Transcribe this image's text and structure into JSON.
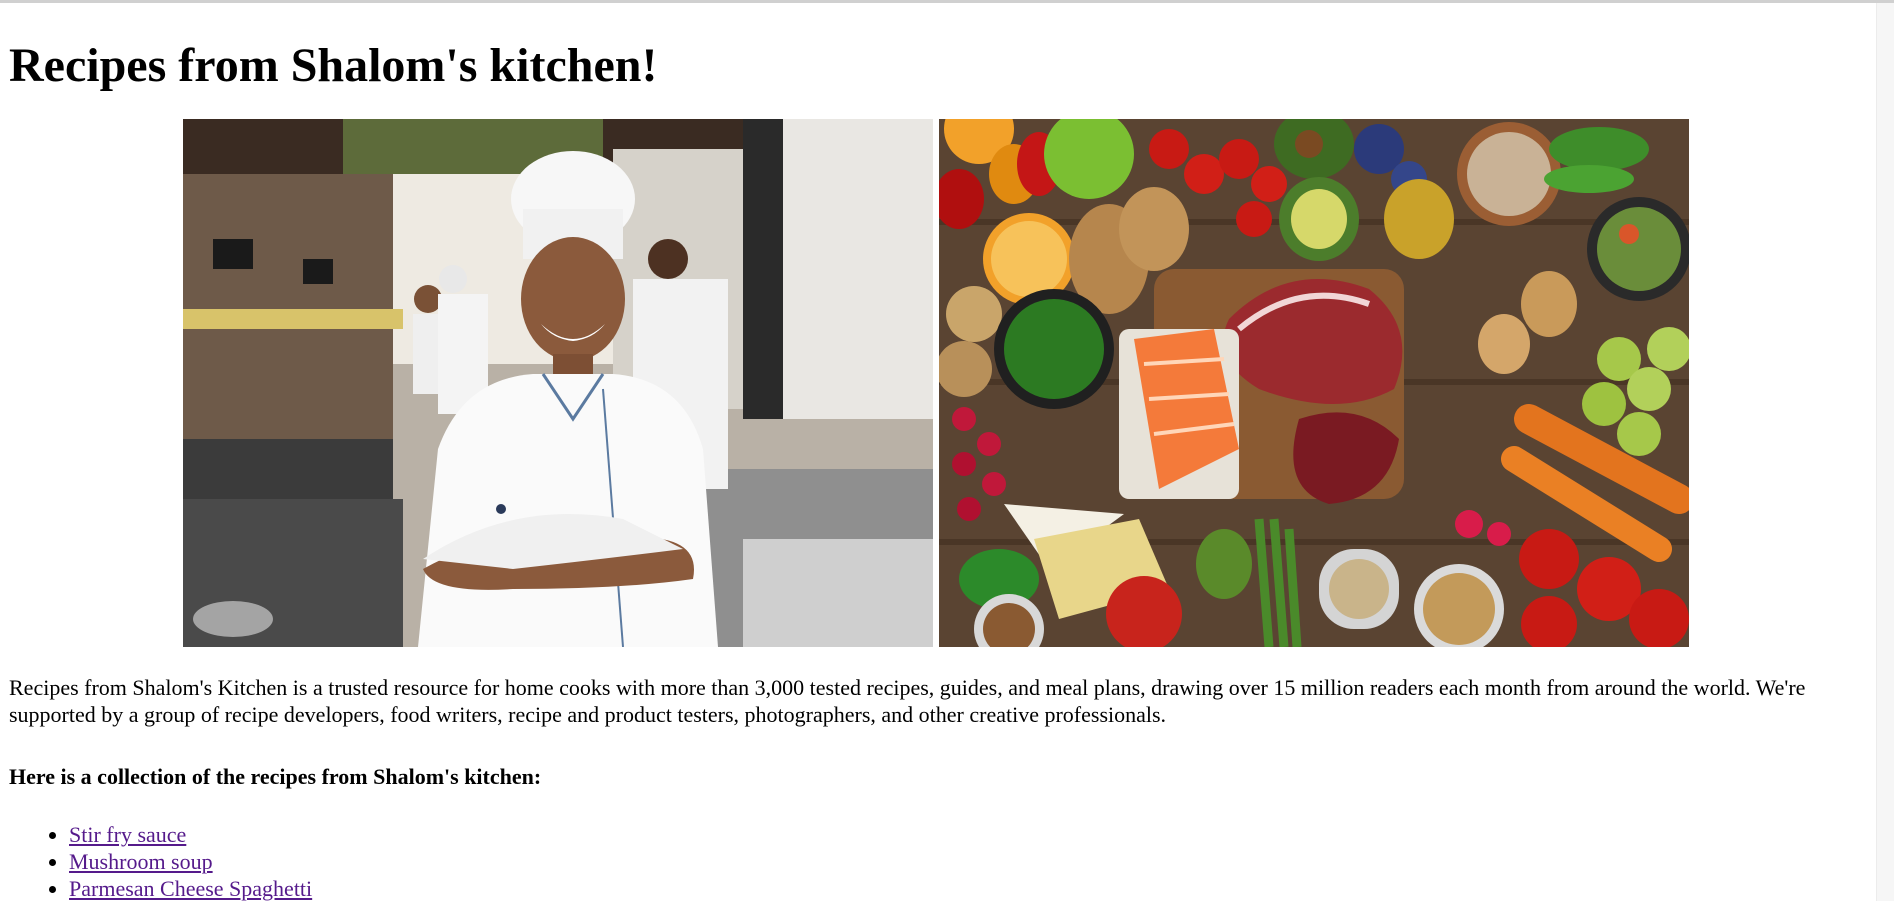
{
  "page": {
    "title": "Recipes from Shalom's kitchen!",
    "intro": "Recipes from Shalom's Kitchen is a trusted resource for home cooks with more than 3,000 tested recipes, guides, and meal plans, drawing over 15 million readers each month from around the world. We're supported by a group of recipe developers, food writers, recipe and product testers, photographers, and other creative professionals.",
    "collection_heading": "Here is a collection of the recipes from Shalom's kitchen:"
  },
  "images": [
    {
      "subject": "chef-in-restaurant-kitchen"
    },
    {
      "subject": "assorted-fresh-food-ingredients"
    }
  ],
  "recipes": [
    {
      "label": "Stir fry sauce"
    },
    {
      "label": "Mushroom soup"
    },
    {
      "label": "Parmesan Cheese Spaghetti"
    }
  ],
  "colors": {
    "visited_link": "#551a8b",
    "text": "#000000",
    "background": "#ffffff"
  }
}
